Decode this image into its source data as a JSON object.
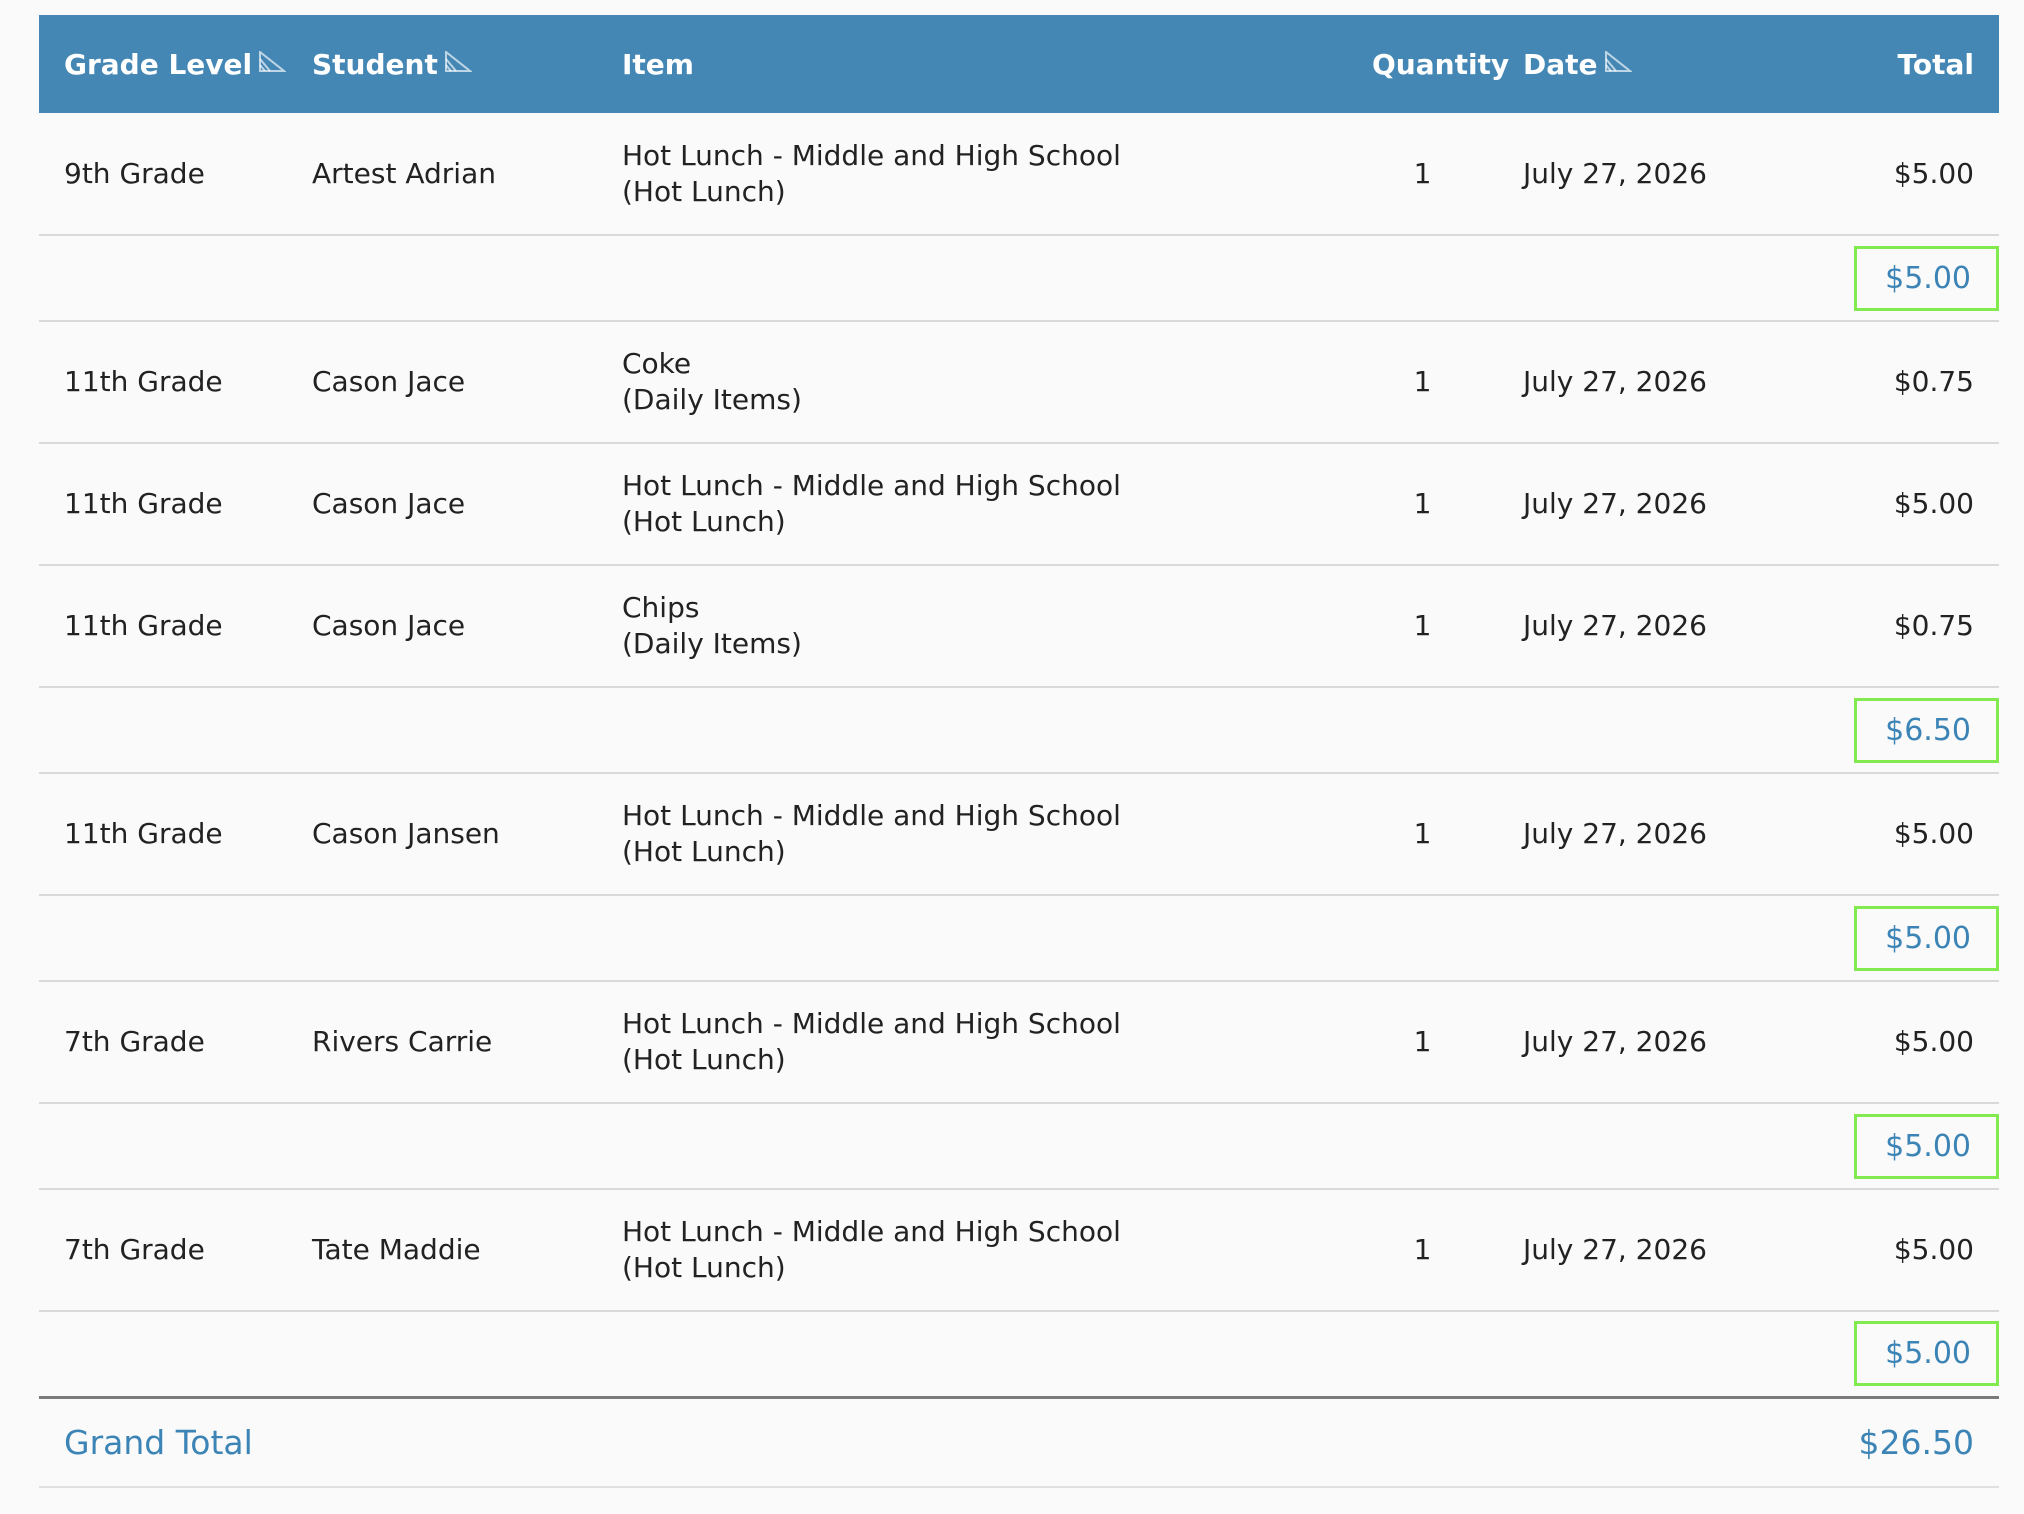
{
  "table": {
    "headers": {
      "grade_level": "Grade Level",
      "student": "Student",
      "item": "Item",
      "quantity": "Quantity",
      "date": "Date",
      "total": "Total"
    },
    "groups": [
      {
        "rows": [
          {
            "grade": "9th Grade",
            "student": "Artest Adrian",
            "item": "Hot Lunch - Middle and High School",
            "category": "(Hot Lunch)",
            "quantity": "1",
            "date": "July 27, 2026",
            "total": "$5.00"
          }
        ],
        "subtotal": "$5.00"
      },
      {
        "rows": [
          {
            "grade": "11th Grade",
            "student": "Cason Jace",
            "item": "Coke",
            "category": "(Daily Items)",
            "quantity": "1",
            "date": "July 27, 2026",
            "total": "$0.75"
          },
          {
            "grade": "11th Grade",
            "student": "Cason Jace",
            "item": "Hot Lunch - Middle and High School",
            "category": "(Hot Lunch)",
            "quantity": "1",
            "date": "July 27, 2026",
            "total": "$5.00"
          },
          {
            "grade": "11th Grade",
            "student": "Cason Jace",
            "item": "Chips",
            "category": "(Daily Items)",
            "quantity": "1",
            "date": "July 27, 2026",
            "total": "$0.75"
          }
        ],
        "subtotal": "$6.50"
      },
      {
        "rows": [
          {
            "grade": "11th Grade",
            "student": "Cason Jansen",
            "item": "Hot Lunch - Middle and High School",
            "category": "(Hot Lunch)",
            "quantity": "1",
            "date": "July 27, 2026",
            "total": "$5.00"
          }
        ],
        "subtotal": "$5.00"
      },
      {
        "rows": [
          {
            "grade": "7th Grade",
            "student": "Rivers Carrie",
            "item": "Hot Lunch - Middle and High School",
            "category": "(Hot Lunch)",
            "quantity": "1",
            "date": "July 27, 2026",
            "total": "$5.00"
          }
        ],
        "subtotal": "$5.00"
      },
      {
        "rows": [
          {
            "grade": "7th Grade",
            "student": "Tate Maddie",
            "item": "Hot Lunch - Middle and High School",
            "category": "(Hot Lunch)",
            "quantity": "1",
            "date": "July 27, 2026",
            "total": "$5.00"
          }
        ],
        "subtotal": "$5.00"
      }
    ],
    "grand_total_label": "Grand Total",
    "grand_total_value": "$26.50"
  },
  "colors": {
    "header_bg": "#4487b5",
    "accent_blue": "#3c84b5",
    "highlight_green": "#82ea4f"
  },
  "icons": {
    "sort": "sort-icon"
  }
}
